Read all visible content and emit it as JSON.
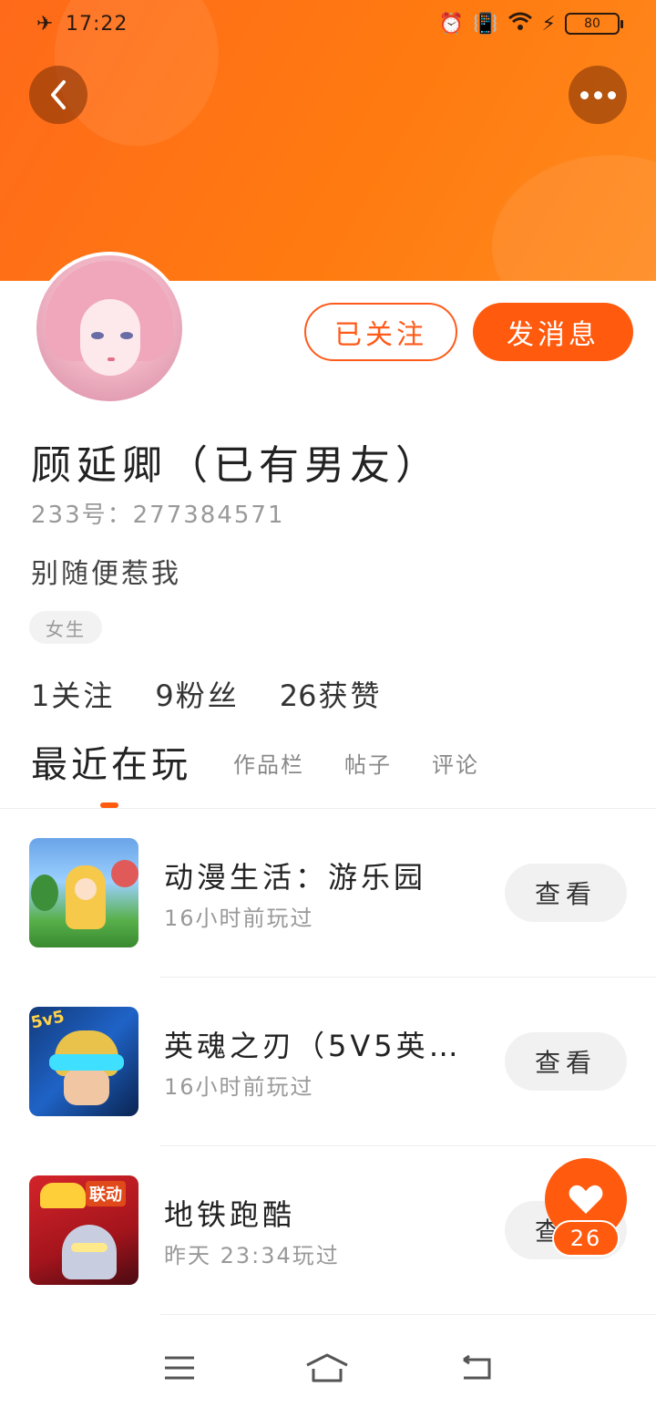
{
  "status_bar": {
    "time": "17:22",
    "battery": "80"
  },
  "profile": {
    "followed_label": "已关注",
    "message_label": "发消息",
    "nickname": "顾延卿（已有男友）",
    "uid": "233号：277384571",
    "bio": "别随便惹我",
    "gender_tag": "女生"
  },
  "stats": [
    {
      "num": "1",
      "label": "关注"
    },
    {
      "num": "9",
      "label": "粉丝"
    },
    {
      "num": "26",
      "label": "获赞"
    }
  ],
  "tabs": [
    "最近在玩",
    "作品栏",
    "帖子",
    "评论"
  ],
  "games": [
    {
      "title": "动漫生活：游乐园",
      "time": "16小时前玩过",
      "action": "查看"
    },
    {
      "title": "英魂之刃（5V5英…",
      "time": "16小时前玩过",
      "action": "查看"
    },
    {
      "title": "地铁跑酷",
      "time": "昨天 23:34玩过",
      "action": "查看"
    }
  ],
  "game_icon_text": {
    "hero": "5v5",
    "subway": "联动"
  },
  "like": {
    "count": "26"
  },
  "colors": {
    "accent": "#ff5a0e",
    "header": "#ff7a10"
  },
  "icons": [
    "airplane-icon",
    "alarm-icon",
    "vibrate-icon",
    "wifi-icon",
    "charging-icon",
    "back-arrow-icon",
    "more-icon",
    "heart-icon",
    "menu-icon",
    "home-icon",
    "return-icon"
  ]
}
